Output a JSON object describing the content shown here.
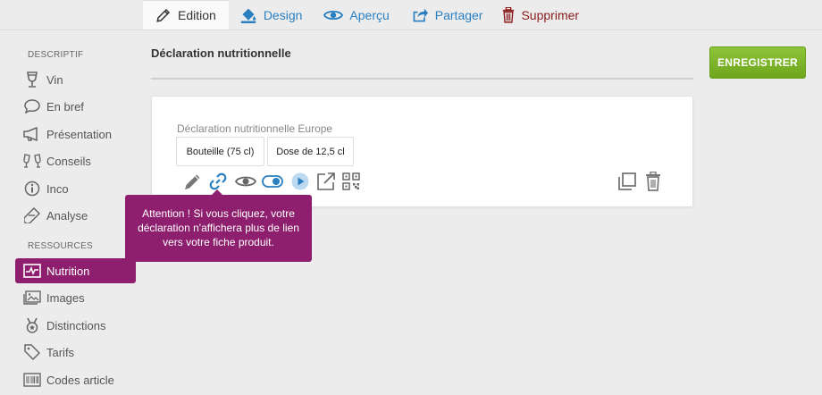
{
  "tabs": [
    {
      "label": "Edition",
      "icon": "pencil-icon",
      "active": true
    },
    {
      "label": "Design",
      "icon": "paint-bucket-icon"
    },
    {
      "label": "Aperçu",
      "icon": "eye-icon"
    },
    {
      "label": "Partager",
      "icon": "share-icon"
    },
    {
      "label": "Supprimer",
      "icon": "trash-icon"
    }
  ],
  "sidebar": {
    "section1": "DESCRIPTIF",
    "section2": "RESSOURCES",
    "items": [
      {
        "label": "Vin",
        "icon": "wine-glass-icon"
      },
      {
        "label": "En bref",
        "icon": "speech-bubble-icon"
      },
      {
        "label": "Présentation",
        "icon": "megaphone-icon"
      },
      {
        "label": "Conseils",
        "icon": "glasses-toast-icon"
      },
      {
        "label": "Inco",
        "icon": "info-icon"
      },
      {
        "label": "Analyse",
        "icon": "test-tube-icon"
      },
      {
        "label": "Nutrition",
        "icon": "heartbeat-monitor-icon",
        "active": true
      },
      {
        "label": "Images",
        "icon": "images-icon"
      },
      {
        "label": "Distinctions",
        "icon": "medal-icon"
      },
      {
        "label": "Tarifs",
        "icon": "price-tag-icon"
      },
      {
        "label": "Codes article",
        "icon": "barcode-icon"
      }
    ]
  },
  "main": {
    "title": "Déclaration nutritionnelle",
    "save_label": "ENREGISTRER",
    "card": {
      "label": "Déclaration nutritionnelle Europe",
      "pills": [
        "Bouteille (75 cl)",
        "Dose de 12,5 cl"
      ]
    },
    "tooltip": "Attention ! Si vous cliquez, votre déclaration n'affichera plus de lien vers votre fiche produit."
  },
  "colors": {
    "accent": "#8e1f6f",
    "link": "#2a7fc1",
    "save": "#7cb32a",
    "danger": "#8a1c1c"
  }
}
